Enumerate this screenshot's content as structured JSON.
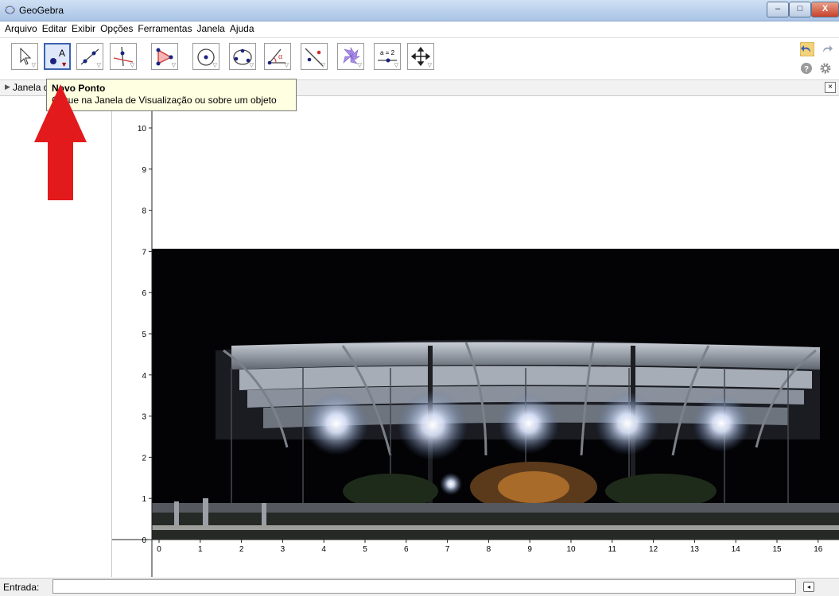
{
  "window": {
    "title": "GeoGebra",
    "minimize": "–",
    "maximize": "□",
    "close": "X"
  },
  "menu": [
    "Arquivo",
    "Editar",
    "Exibir",
    "Opções",
    "Ferramentas",
    "Janela",
    "Ajuda"
  ],
  "toolbar": {
    "tools": [
      {
        "icon": "move-arrow-icon"
      },
      {
        "icon": "point-icon",
        "letter": "A",
        "active": true
      },
      {
        "icon": "line-icon"
      },
      {
        "icon": "perpendicular-line-icon"
      },
      {
        "icon": "polygon-icon"
      },
      {
        "icon": "circle-icon"
      },
      {
        "icon": "conic-icon"
      },
      {
        "icon": "angle-icon",
        "letter": "α"
      },
      {
        "icon": "reflect-icon"
      },
      {
        "icon": "pinwheel-icon"
      },
      {
        "icon": "slider-icon",
        "letter": "a = 2"
      },
      {
        "icon": "move-graphics-icon"
      }
    ],
    "right_icons": [
      "undo-icon",
      "redo-icon",
      "help-icon",
      "settings-icon"
    ]
  },
  "tooltip": {
    "title": "Novo Ponto",
    "description": "Clique na Janela de Visualização ou sobre um objeto"
  },
  "view_header": {
    "label": "Janela de Visualização"
  },
  "graphics": {
    "x_ticks": [
      "0",
      "1",
      "2",
      "3",
      "4",
      "5",
      "6",
      "7",
      "8",
      "9",
      "10",
      "11",
      "12",
      "13",
      "14",
      "15",
      "16"
    ],
    "y_ticks": [
      "0",
      "1",
      "2",
      "3",
      "4",
      "5",
      "6",
      "7",
      "8",
      "9",
      "10"
    ]
  },
  "input_bar": {
    "label": "Entrada:",
    "value": ""
  },
  "colors": {
    "tooltip_bg": "#ffffe1",
    "arrow": "#e31a1c",
    "active_tool": "#3c62ac",
    "point": "#1a237e"
  }
}
